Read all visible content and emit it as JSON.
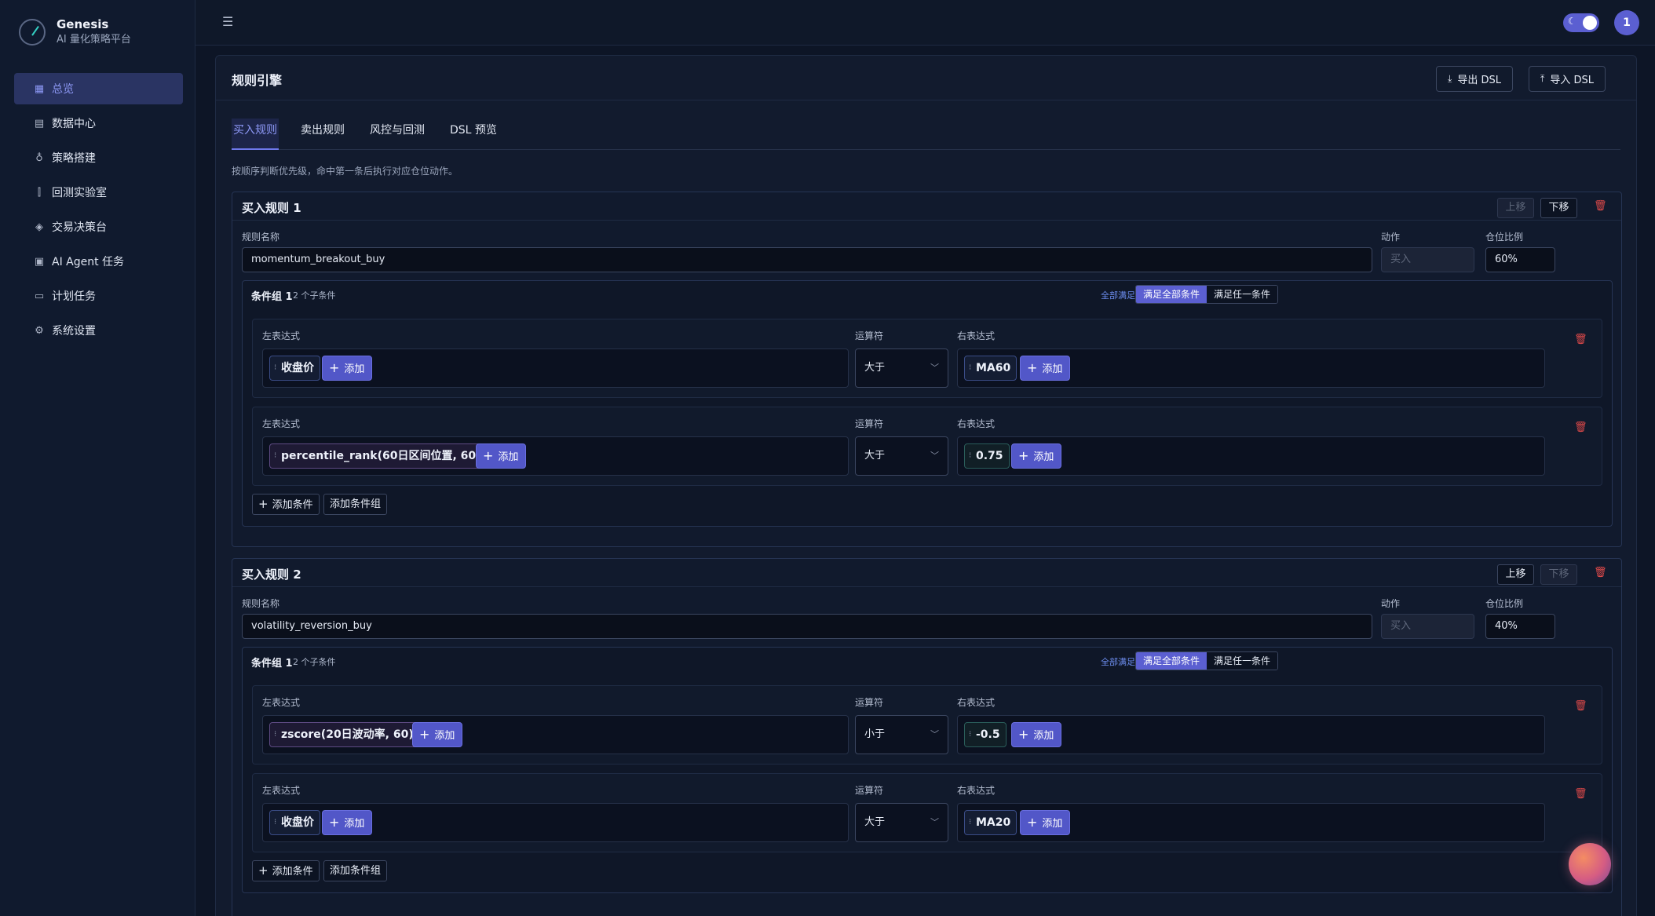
{
  "brand": {
    "title": "Genesis",
    "subtitle": "AI 量化策略平台"
  },
  "sidebar": {
    "items": [
      {
        "label": "总览",
        "icon": "grid-icon",
        "active": true
      },
      {
        "label": "数据中心",
        "icon": "database-icon"
      },
      {
        "label": "策略搭建",
        "icon": "bulb-icon"
      },
      {
        "label": "回测实验室",
        "icon": "bar-chart-icon"
      },
      {
        "label": "交易决策台",
        "icon": "diamond-icon"
      },
      {
        "label": "AI Agent 任务",
        "icon": "robot-icon"
      },
      {
        "label": "计划任务",
        "icon": "calendar-icon"
      },
      {
        "label": "系统设置",
        "icon": "gear-icon"
      }
    ]
  },
  "header": {
    "avatar": "1",
    "theme": "dark"
  },
  "page": {
    "title": "规则引擎",
    "export_label": "导出 DSL",
    "import_label": "导入 DSL",
    "tabs": [
      "买入规则",
      "卖出规则",
      "风控与回测",
      "DSL 预览"
    ],
    "active_tab": "买入规则",
    "hint": "按顺序判断优先级，命中第一条后执行对应仓位动作。"
  },
  "labels": {
    "rule_name": "规则名称",
    "action": "动作",
    "position_ratio": "仓位比例",
    "left_expr": "左表达式",
    "operator": "运算符",
    "right_expr": "右表达式",
    "add": "添加",
    "move_up": "上移",
    "move_down": "下移",
    "all_met": "全部满足",
    "mode_all": "满足全部条件",
    "mode_any": "满足任一条件",
    "add_condition": "添加条件",
    "add_condition_group": "添加条件组"
  },
  "rules": [
    {
      "title": "买入规则 1",
      "name": "momentum_breakout_buy",
      "action": "买入",
      "ratio": "60%",
      "group": {
        "title": "条件组 1",
        "count": "2 个子条件",
        "conditions": [
          {
            "left": "收盘价",
            "op": "大于",
            "right": "MA60"
          },
          {
            "left": "percentile_rank(60日区间位置, 60)",
            "op": "大于",
            "right": "0.75"
          }
        ]
      }
    },
    {
      "title": "买入规则 2",
      "name": "volatility_reversion_buy",
      "action": "买入",
      "ratio": "40%",
      "group": {
        "title": "条件组 1",
        "count": "2 个子条件",
        "conditions": [
          {
            "left": "zscore(20日波动率, 60)",
            "op": "小于",
            "right": "-0.5"
          },
          {
            "left": "收盘价",
            "op": "大于",
            "right": "MA20"
          }
        ]
      }
    }
  ],
  "colors": {
    "accent": "#5b5fd1",
    "background": "#0d1526",
    "danger": "#e14a4a"
  }
}
